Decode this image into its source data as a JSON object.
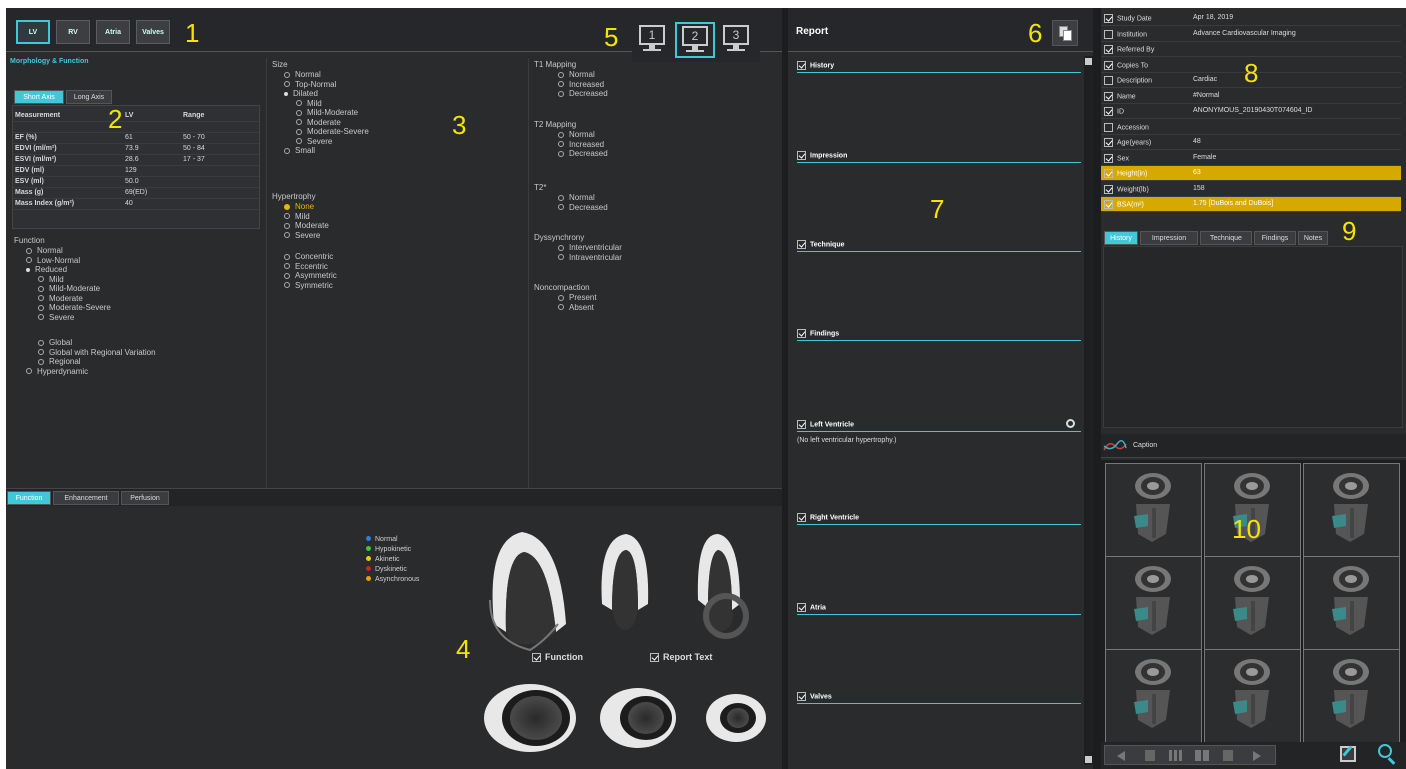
{
  "callouts": [
    "1",
    "2",
    "3",
    "4",
    "5",
    "6",
    "7",
    "8",
    "9",
    "10"
  ],
  "topTabs": [
    "LV",
    "RV",
    "Atria",
    "Valves"
  ],
  "monitors": [
    "1",
    "2",
    "3"
  ],
  "morph": {
    "title": "Morphology & Function",
    "axisTabs": [
      "Short Axis",
      "Long Axis"
    ],
    "table": {
      "headers": [
        "Measurement",
        "LV",
        "Range"
      ],
      "rows": [
        [
          "EF (%)",
          "61",
          "50 - 70"
        ],
        [
          "EDVI (ml/m²)",
          "73.9",
          "50 - 84"
        ],
        [
          "ESVI (ml/m²)",
          "28.6",
          "17 - 37"
        ],
        [
          "EDV (ml)",
          "129",
          ""
        ],
        [
          "ESV (ml)",
          "50.0",
          ""
        ],
        [
          "Mass (g)",
          "69(ED)",
          ""
        ],
        [
          "Mass Index (g/m²)",
          "40",
          ""
        ]
      ]
    },
    "function": {
      "title": "Function",
      "items": [
        "Normal",
        "Low-Normal",
        "Reduced",
        "Mild",
        "Mild-Moderate",
        "Moderate",
        "Moderate-Severe",
        "Severe",
        "Global",
        "Global with Regional Variation",
        "Regional",
        "Hyperdynamic"
      ]
    },
    "size": {
      "title": "Size",
      "items": [
        "Normal",
        "Top-Normal",
        "Dilated",
        "Mild",
        "Mild-Moderate",
        "Moderate",
        "Moderate-Severe",
        "Severe",
        "Small"
      ]
    },
    "hypertrophy": {
      "title": "Hypertrophy",
      "items": [
        "None",
        "Mild",
        "Moderate",
        "Severe",
        "Concentric",
        "Eccentric",
        "Asymmetric",
        "Symmetric"
      ]
    },
    "t1": {
      "title": "T1 Mapping",
      "items": [
        "Normal",
        "Increased",
        "Decreased"
      ]
    },
    "t2": {
      "title": "T2 Mapping",
      "items": [
        "Normal",
        "Increased",
        "Decreased"
      ]
    },
    "t2star": {
      "title": "T2*",
      "items": [
        "Normal",
        "Decreased"
      ]
    },
    "dys": {
      "title": "Dyssynchrony",
      "items": [
        "Interventricular",
        "Intraventricular"
      ]
    },
    "noncomp": {
      "title": "Noncompaction",
      "items": [
        "Present",
        "Absent"
      ]
    }
  },
  "bottomTabs": [
    "Function",
    "Enhancement",
    "Perfusion"
  ],
  "legend": [
    {
      "label": "Normal",
      "color": "#2e7de0"
    },
    {
      "label": "Hypokinetic",
      "color": "#3cc83c"
    },
    {
      "label": "Akinetic",
      "color": "#e8d000"
    },
    {
      "label": "Dyskinetic",
      "color": "#d02020"
    },
    {
      "label": "Asynchronous",
      "color": "#e8a000"
    }
  ],
  "diagramChecks": [
    "Function",
    "Report Text"
  ],
  "report": {
    "title": "Report",
    "sections": [
      "History",
      "Impression",
      "Technique",
      "Findings",
      "Left Ventricle",
      "Right Ventricle",
      "Atria",
      "Valves"
    ],
    "lvText": "(No left ventricular hypertrophy.)"
  },
  "meta": [
    {
      "label": "Study Date",
      "value": "Apr 18, 2019",
      "checked": true,
      "hl": false
    },
    {
      "label": "Institution",
      "value": "Advance Cardiovascular Imaging",
      "checked": false,
      "hl": false
    },
    {
      "label": "Referred By",
      "value": "",
      "checked": true,
      "hl": false
    },
    {
      "label": "Copies To",
      "value": "",
      "checked": true,
      "hl": false
    },
    {
      "label": "Description",
      "value": "Cardiac",
      "checked": false,
      "hl": false
    },
    {
      "label": "Name",
      "value": "#Normal",
      "checked": true,
      "hl": false
    },
    {
      "label": "ID",
      "value": "ANONYMOUS_20190430T074604_ID",
      "checked": true,
      "hl": false
    },
    {
      "label": "Accession",
      "value": "",
      "checked": false,
      "hl": false
    },
    {
      "label": "Age(years)",
      "value": "48",
      "checked": true,
      "hl": false
    },
    {
      "label": "Sex",
      "value": "Female",
      "checked": true,
      "hl": false
    },
    {
      "label": "Height(in)",
      "value": "63",
      "checked": true,
      "hl": true
    },
    {
      "label": "Weight(lb)",
      "value": "158",
      "checked": true,
      "hl": false
    },
    {
      "label": "BSA(m²)",
      "value": "1.75 [DuBois and DuBois]",
      "checked": true,
      "hl": true
    }
  ],
  "notesTabs": [
    "History",
    "Impression",
    "Technique",
    "Findings",
    "Notes"
  ],
  "caption": "Caption"
}
